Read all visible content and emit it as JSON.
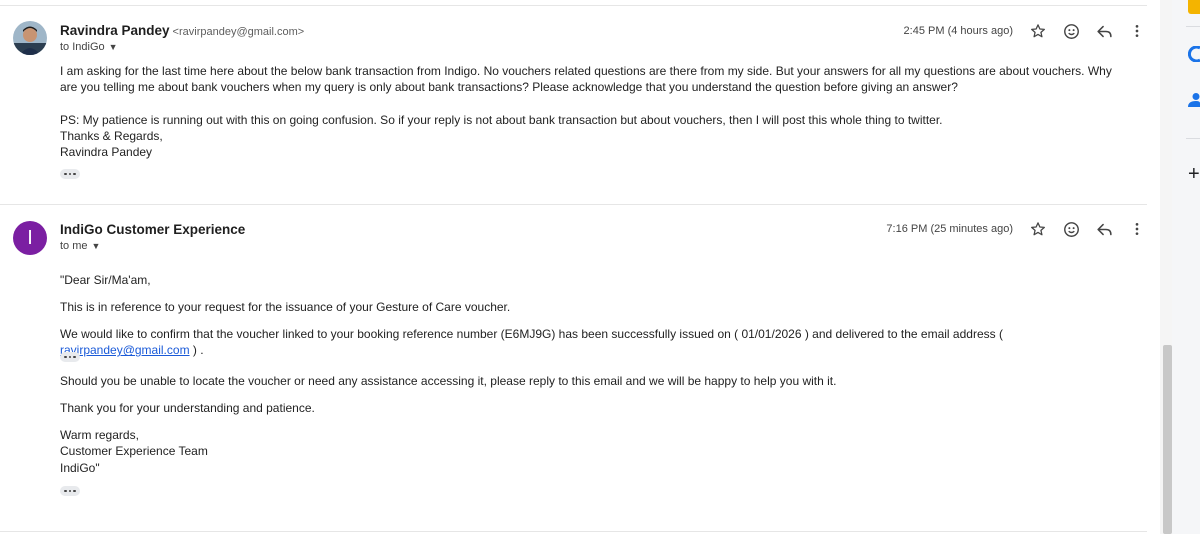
{
  "messages": [
    {
      "sender_name": "Ravindra Pandey",
      "sender_email": "<ravirpandey@gmail.com>",
      "to_label": "to IndiGo",
      "time": "2:45 PM (4 hours ago)",
      "body": {
        "p1": "I am asking for the last time here about the below bank transaction from Indigo. No vouchers related questions are there from my side. But your answers for all my questions are about vouchers. Why are you telling me about bank vouchers when my query is only about bank transactions? Please acknowledge that you understand the question before giving an answer?",
        "p2": "PS: My patience is running out with this on going confusion. So if your reply is not about bank transaction but about vouchers, then I will post this whole thing to twitter.",
        "sign1": "Thanks & Regards,",
        "sign2": "Ravindra Pandey"
      }
    },
    {
      "sender_name": "IndiGo Customer Experience",
      "avatar_letter": "I",
      "to_label": "to me",
      "time": "7:16 PM (25 minutes ago)",
      "body": {
        "greeting": "\"Dear Sir/Ma'am,",
        "p1": "This is in reference to your request for the issuance of your Gesture of Care voucher.",
        "p2_before": "We would like to confirm that the voucher linked to your booking reference number (E6MJ9G) has been successfully issued on ( 01/01/2026 ) and delivered to the email address ( ",
        "p2_link": "ravirpandey@gmail.com",
        "p2_after": " ) .",
        "p3": "Should you be unable to locate the voucher or need any assistance accessing it, please reply to this email and we will be happy to help you with it.",
        "p4": "Thank you for your understanding and patience.",
        "sign1": "Warm regards,",
        "sign2": "Customer Experience Team",
        "sign3": "IndiGo\""
      }
    }
  ],
  "icons": [
    "star-icon",
    "emoji-icon",
    "reply-icon",
    "more-vert-icon",
    "dropdown-caret-icon",
    "show-trimmed-icon",
    "calendar-icon",
    "tasks-icon",
    "contacts-icon",
    "add-icon"
  ],
  "colors": {
    "link": "#1a5ad8",
    "avatar_purple": "#7b1fa2",
    "calendar_yellow": "#f4b400",
    "tasks_blue": "#1a73e8"
  }
}
